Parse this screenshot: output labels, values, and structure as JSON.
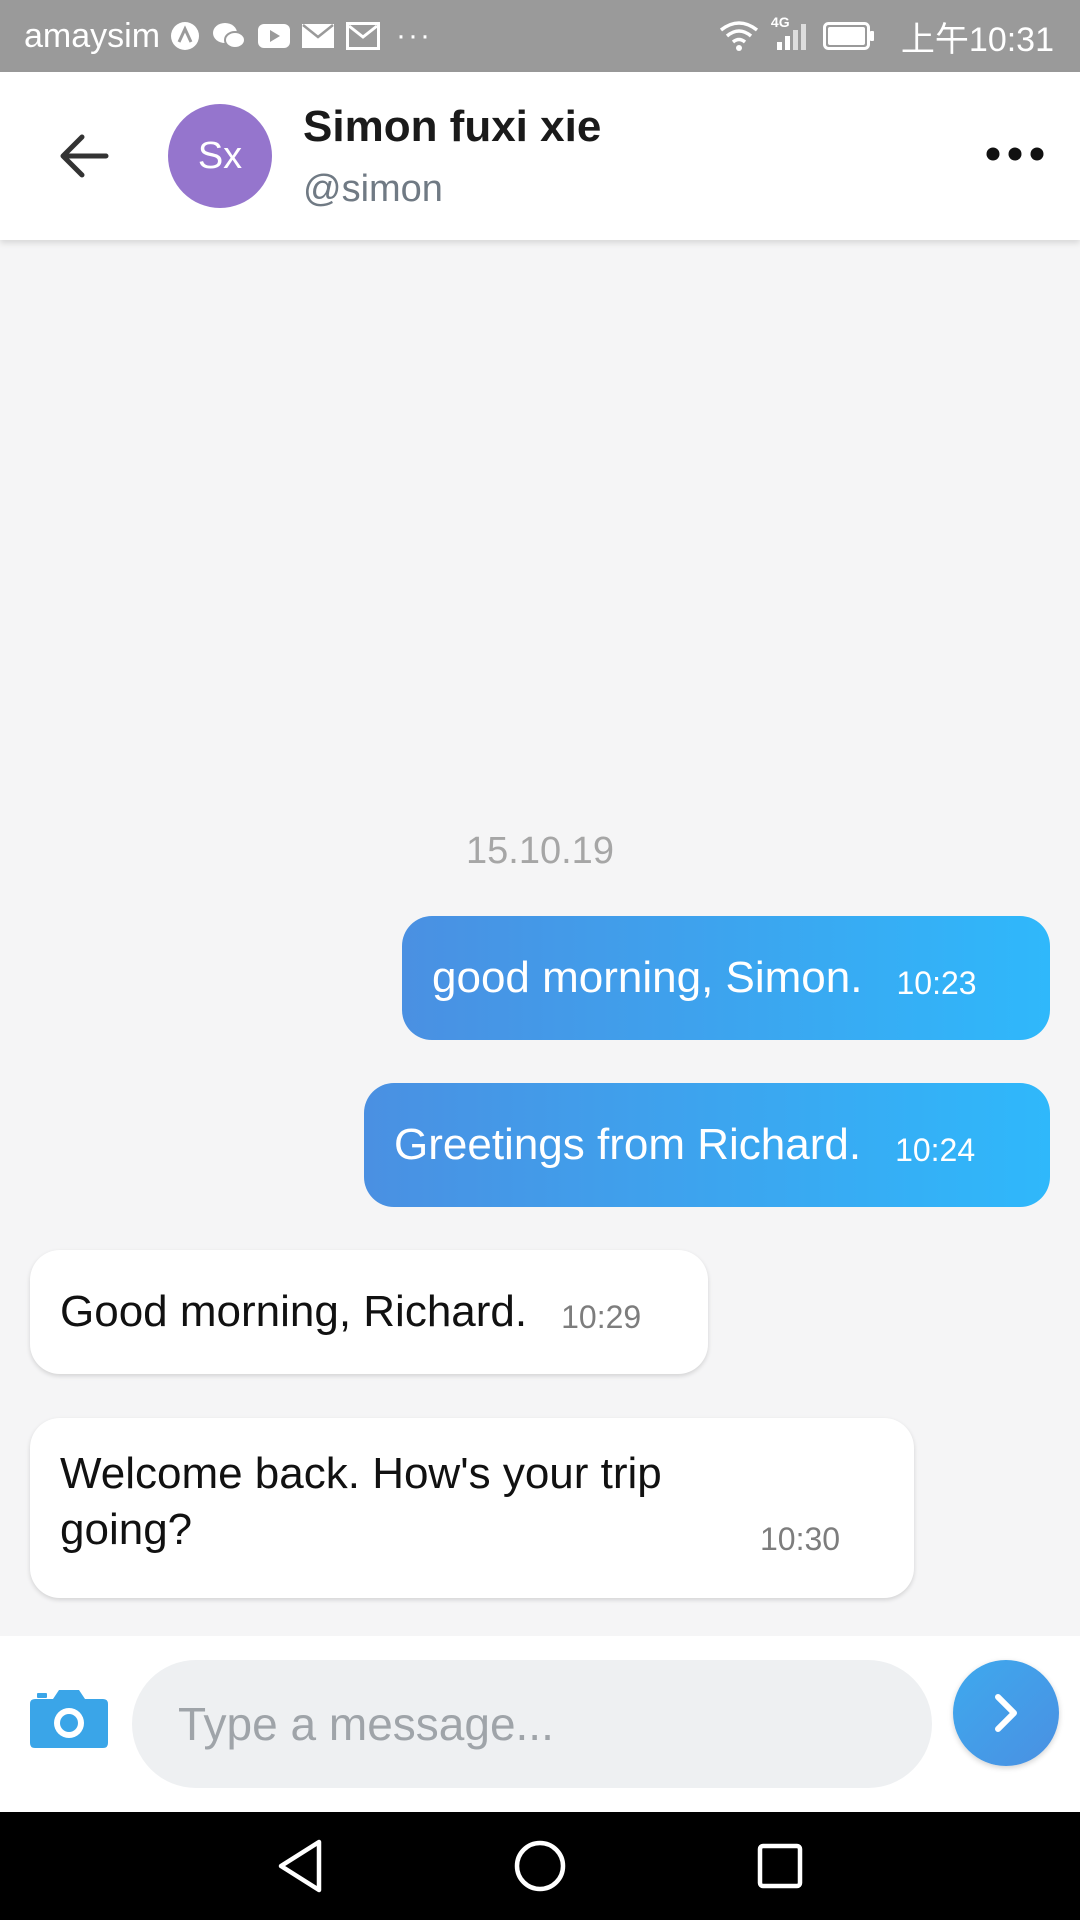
{
  "status_bar": {
    "carrier": "amaysim",
    "network": "4G",
    "time": "上午10:31",
    "overflow": "···",
    "icons": [
      "app-a-icon",
      "wechat-icon",
      "youtube-icon",
      "mail-icon",
      "gmail-icon",
      "wifi-icon",
      "signal-icon",
      "battery-icon"
    ]
  },
  "header": {
    "avatar_initials": "Sx",
    "avatar_color": "#9575cd",
    "name": "Simon fuxi xie",
    "handle": "@simon"
  },
  "conversation": {
    "date": "15.10.19",
    "messages": [
      {
        "direction": "outgoing",
        "text": "good morning, Simon.",
        "time": "10:23"
      },
      {
        "direction": "outgoing",
        "text": "Greetings from Richard.",
        "time": "10:24"
      },
      {
        "direction": "incoming",
        "text": "Good morning, Richard.",
        "time": "10:29"
      },
      {
        "direction": "incoming",
        "text": "Welcome back. How's your trip going?",
        "time": "10:30"
      }
    ]
  },
  "composer": {
    "placeholder": "Type a message...",
    "value": ""
  },
  "colors": {
    "accent_start": "#4a90e2",
    "accent_end": "#2fb8fb",
    "avatar": "#9575cd"
  }
}
